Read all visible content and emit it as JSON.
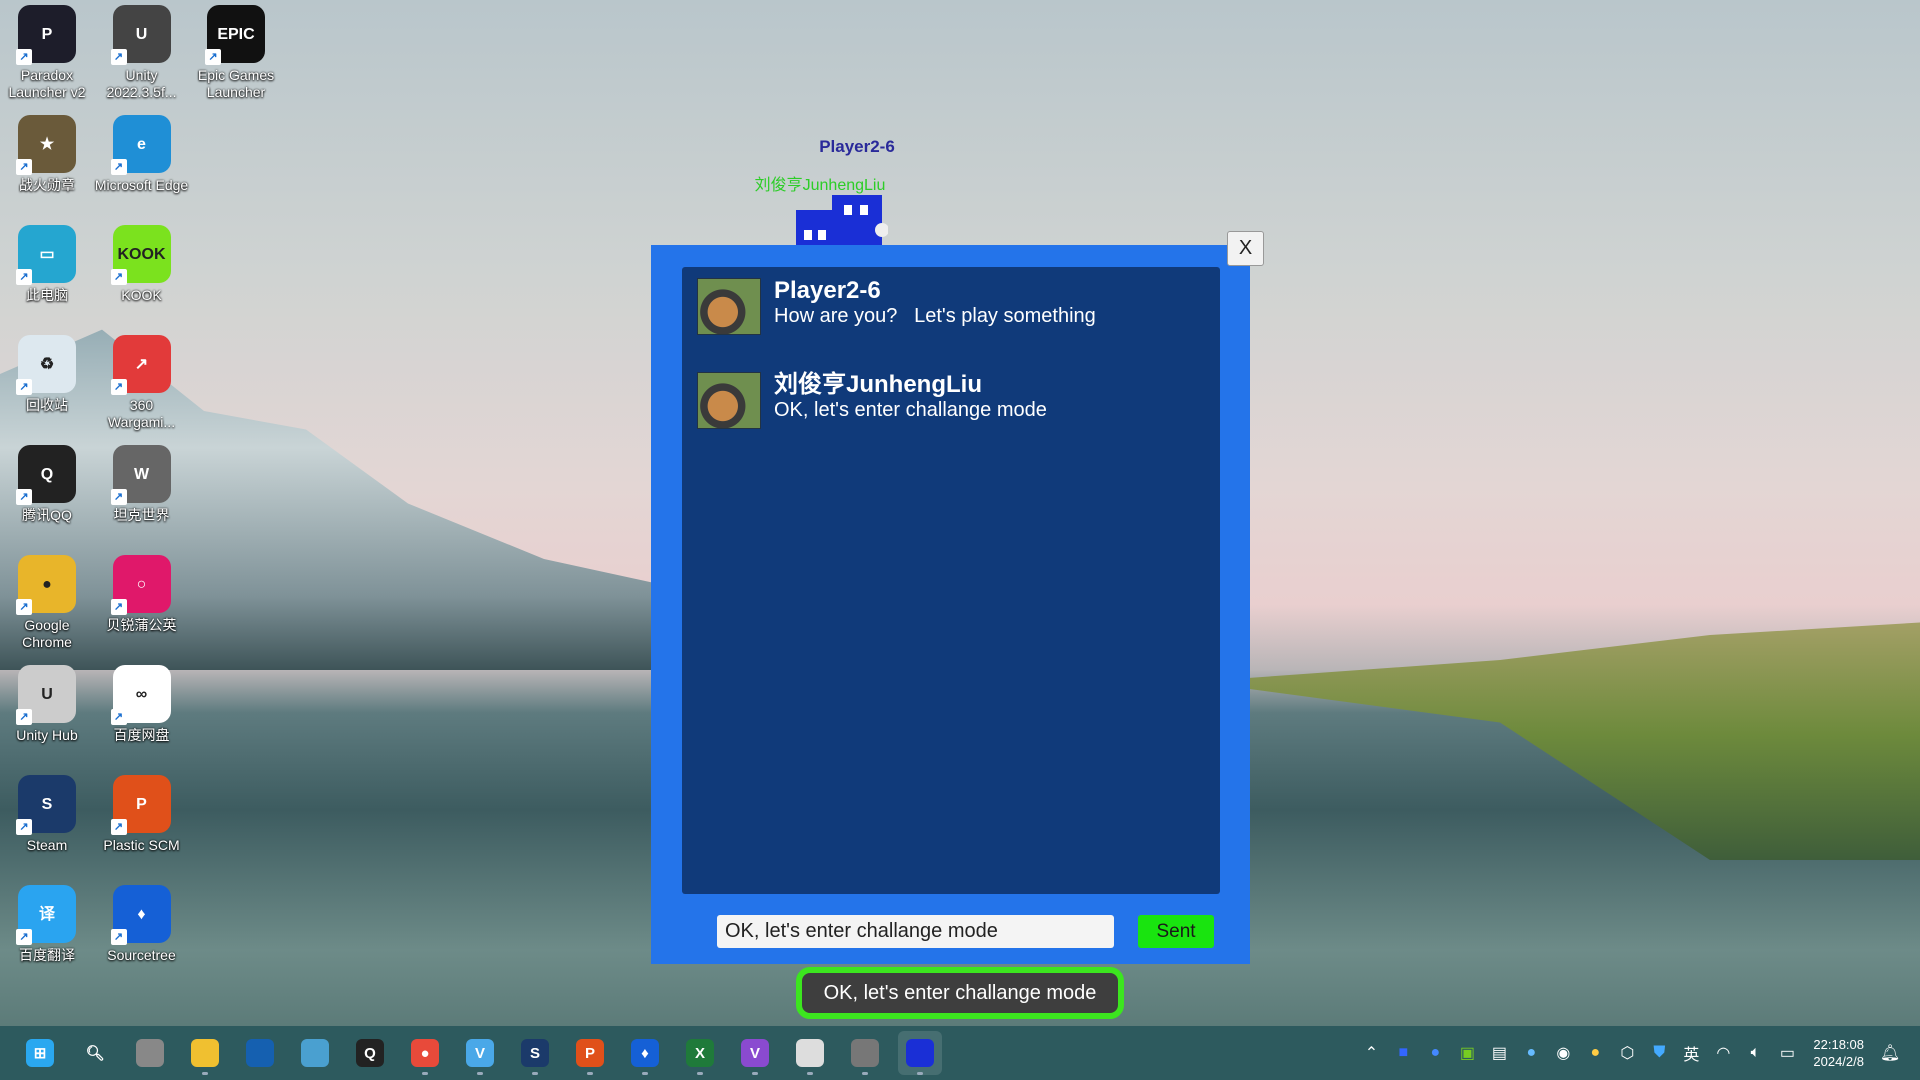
{
  "desktop": {
    "icons": [
      {
        "label": "Paradox Launcher v2",
        "glyph": "P",
        "bg": "#1d1d2a"
      },
      {
        "label": "Unity 2022.3.5f...",
        "glyph": "U",
        "bg": "#444"
      },
      {
        "label": "Epic Games Launcher",
        "glyph": "EPIC",
        "bg": "#111"
      },
      {
        "label": "战火勋章",
        "glyph": "★",
        "bg": "#6a5a3a"
      },
      {
        "label": "Microsoft Edge",
        "glyph": "e",
        "bg": "#1f8fd6"
      },
      {
        "label": "此电脑",
        "glyph": "▭",
        "bg": "#25a6d0"
      },
      {
        "label": "KOOK",
        "glyph": "KOOK",
        "bg": "#7be21e"
      },
      {
        "label": "回收站",
        "glyph": "♻",
        "bg": "#dde8ef"
      },
      {
        "label": "360 Wargami...",
        "glyph": "↗",
        "bg": "#e23a3a"
      },
      {
        "label": "腾讯QQ",
        "glyph": "Q",
        "bg": "#222"
      },
      {
        "label": "坦克世界",
        "glyph": "W",
        "bg": "#666"
      },
      {
        "label": "Google Chrome",
        "glyph": "●",
        "bg": "#e8b52a"
      },
      {
        "label": "贝锐蒲公英",
        "glyph": "○",
        "bg": "#e0186a"
      },
      {
        "label": "Unity Hub",
        "glyph": "U",
        "bg": "#ccc"
      },
      {
        "label": "百度网盘",
        "glyph": "∞",
        "bg": "#fff"
      },
      {
        "label": "Steam",
        "glyph": "S",
        "bg": "#1b3a6a"
      },
      {
        "label": "Plastic SCM",
        "glyph": "P",
        "bg": "#e0501a"
      },
      {
        "label": "百度翻译",
        "glyph": "译",
        "bg": "#2aa4f0"
      },
      {
        "label": "Sourcetree",
        "glyph": "♦",
        "bg": "#1560d6"
      }
    ]
  },
  "game": {
    "player_label": "Player2-6",
    "self_label": "刘俊亨JunhengLiu"
  },
  "chat": {
    "close_label": "X",
    "messages": [
      {
        "name": "Player2-6",
        "text": "How are you?   Let's play something"
      },
      {
        "name": "刘俊亨JunhengLiu",
        "text": "OK, let's enter challange mode"
      }
    ],
    "input_value": "OK, let's enter challange mode",
    "send_label": "Sent",
    "bubble_text": "OK, let's enter challange mode"
  },
  "taskbar": {
    "apps": [
      "start",
      "search",
      "task-view",
      "file-explorer",
      "store",
      "control-panel",
      "qq",
      "chrome",
      "vscode-like",
      "steam",
      "plastic-scm",
      "sourcetree",
      "excel",
      "visual-studio",
      "unity",
      "unity-hub",
      "game"
    ],
    "tray": {
      "ime": "英",
      "time": "22:18:08",
      "date": "2024/2/8"
    }
  }
}
